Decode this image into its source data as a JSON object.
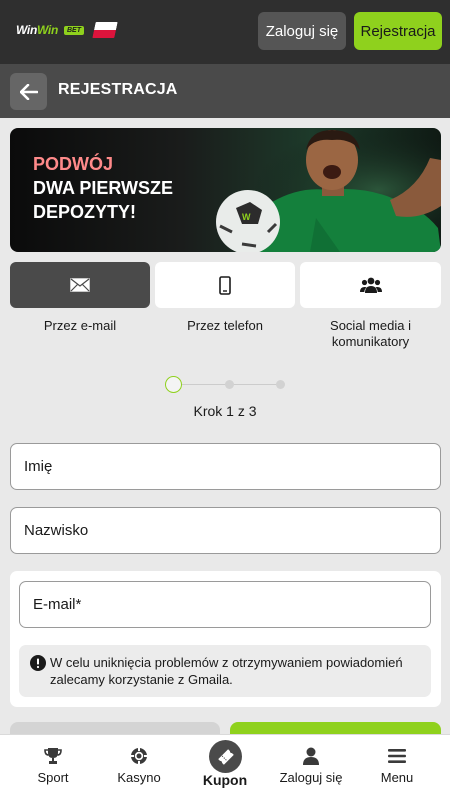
{
  "header": {
    "logo_win1": "Win",
    "logo_win2": "Win",
    "logo_bet": "BET",
    "login_label": "Zaloguj się",
    "register_label": "Rejestracja"
  },
  "page": {
    "title": "REJESTRACJA"
  },
  "banner": {
    "line1": "PODWÓJ",
    "line2": "DWA PIERWSZE",
    "line3": "DEPOZYTY!"
  },
  "methods": [
    {
      "label": "Przez e-mail",
      "icon": "envelope-icon",
      "selected": true
    },
    {
      "label": "Przez telefon",
      "icon": "phone-icon",
      "selected": false
    },
    {
      "label": "Social media i komunikatory",
      "icon": "users-icon",
      "selected": false
    }
  ],
  "stepper": {
    "text": "Krok 1 z 3",
    "current": 1,
    "total": 3
  },
  "form": {
    "first_name_placeholder": "Imię",
    "last_name_placeholder": "Nazwisko",
    "email_placeholder": "E-mail*",
    "notice": "W celu uniknięcia problemów z otrzymywaniem powiadomień zalecamy korzystanie z Gmaila."
  },
  "bottom_nav": [
    {
      "label": "Sport",
      "icon": "trophy-icon"
    },
    {
      "label": "Kasyno",
      "icon": "chip-icon"
    },
    {
      "label": "Kupon",
      "icon": "ticket-icon",
      "active": true
    },
    {
      "label": "Zaloguj się",
      "icon": "user-icon"
    },
    {
      "label": "Menu",
      "icon": "menu-icon"
    }
  ],
  "colors": {
    "accent": "#8fd11d",
    "dark": "#2f2f2f",
    "header": "#4a4a4a",
    "highlight": "#ff8a8a"
  }
}
